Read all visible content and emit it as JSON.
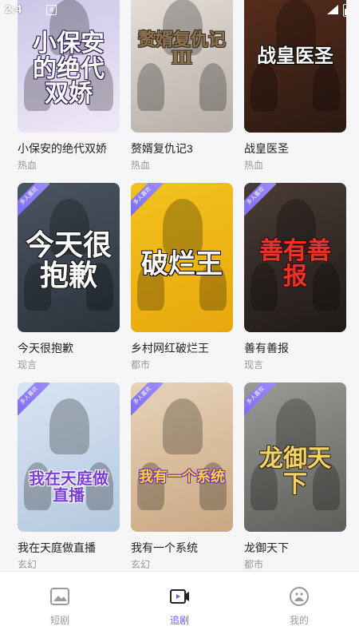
{
  "status_bar": {
    "time": "2:4"
  },
  "dramas": [
    {
      "title": "小保安的绝代双娇",
      "genre": "热血",
      "poster_text": "小保安的绝代双娇",
      "badge": "",
      "colors": [
        "#c9c2e6",
        "#f0e9f7"
      ]
    },
    {
      "title": "赘婿复仇记3",
      "genre": "热血",
      "poster_text": "赘婿复仇记Ⅲ",
      "badge": "",
      "colors": [
        "#e8e2dc",
        "#b6aea7"
      ]
    },
    {
      "title": "战皇医圣",
      "genre": "热血",
      "poster_text": "战皇医圣",
      "badge": "",
      "colors": [
        "#5a2e1c",
        "#2a1a12"
      ]
    },
    {
      "title": "今天很抱歉",
      "genre": "现言",
      "poster_text": "今天很抱歉",
      "badge": "多人喜欢",
      "colors": [
        "#4a5563",
        "#2c333c"
      ]
    },
    {
      "title": "乡村网红破烂王",
      "genre": "都市",
      "poster_text": "破烂王",
      "badge": "多人喜欢",
      "colors": [
        "#f3c21e",
        "#e7a80d"
      ]
    },
    {
      "title": "善有善报",
      "genre": "现言",
      "poster_text": "善有善报",
      "badge": "多人喜欢",
      "colors": [
        "#4a3c36",
        "#1f1a18"
      ]
    },
    {
      "title": "我在天庭做直播",
      "genre": "玄幻",
      "poster_text": "我在天庭做直播",
      "badge": "多人喜欢",
      "colors": [
        "#d7e4f2",
        "#b5c9de"
      ]
    },
    {
      "title": "我有一个系统",
      "genre": "玄幻",
      "poster_text": "我有一个系统",
      "badge": "多人喜欢",
      "colors": [
        "#e8d3b8",
        "#c9a882"
      ]
    },
    {
      "title": "龙御天下",
      "genre": "都市",
      "poster_text": "龙御天下",
      "badge": "多人喜欢",
      "colors": [
        "#9a9a96",
        "#5d5e5a"
      ]
    }
  ],
  "tabs": [
    {
      "label": "短剧",
      "icon": "home-icon",
      "active": false
    },
    {
      "label": "追剧",
      "icon": "video-follow-icon",
      "active": true
    },
    {
      "label": "我的",
      "icon": "profile-icon",
      "active": false
    }
  ],
  "accent_color": "#6a5cf0"
}
